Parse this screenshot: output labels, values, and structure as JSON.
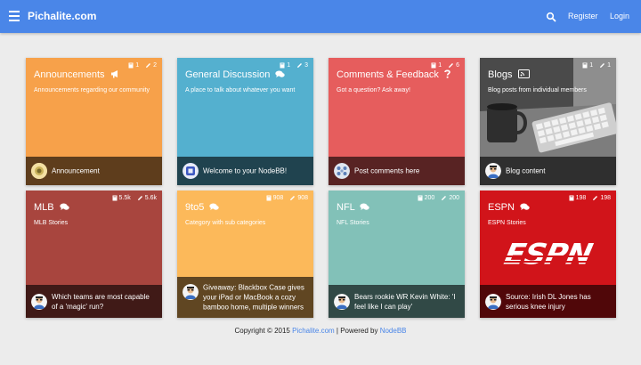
{
  "header": {
    "brand": "Pichalite.com",
    "search_icon": "search-icon",
    "register_label": "Register",
    "login_label": "Login",
    "color": "#4a86e8"
  },
  "categories": [
    {
      "title": "Announcements",
      "icon": "megaphone-icon",
      "description": "Announcements regarding our community",
      "topics": "1",
      "posts": "2",
      "color": "#f7a14a",
      "teaser": "Announcement"
    },
    {
      "title": "General Discussion",
      "icon": "comments-icon",
      "description": "A place to talk about whatever you want",
      "topics": "1",
      "posts": "3",
      "color": "#54b0cf",
      "teaser": "Welcome to your NodeBB!"
    },
    {
      "title": "Comments & Feedback",
      "icon": "question-icon",
      "description": "Got a question? Ask away!",
      "topics": "1",
      "posts": "6",
      "color": "#e65d5d",
      "teaser": "Post comments here"
    },
    {
      "title": "Blogs",
      "icon": "rss-icon",
      "description": "Blog posts from individual members",
      "topics": "1",
      "posts": "1",
      "color": "#5d5d5d",
      "teaser": "Blog content"
    },
    {
      "title": "MLB",
      "icon": "comments-icon",
      "description": "MLB Stories",
      "topics": "5.5k",
      "posts": "5.6k",
      "color": "#a8453e",
      "teaser": "Which teams are most capable of a 'magic' run?"
    },
    {
      "title": "9to5",
      "icon": "comments-icon",
      "description": "Category with sub categories",
      "topics": "908",
      "posts": "908",
      "color": "#fcb95a",
      "teaser": "Giveaway: Blackbox Case gives your iPad or MacBook a cozy bamboo home, multiple winners"
    },
    {
      "title": "NFL",
      "icon": "comments-icon",
      "description": "NFL Stories",
      "topics": "200",
      "posts": "200",
      "color": "#82c1b8",
      "teaser": "Bears rookie WR Kevin White: 'I feel like I can play'"
    },
    {
      "title": "ESPN",
      "icon": "comments-icon",
      "description": "ESPN Stories",
      "topics": "198",
      "posts": "198",
      "color": "#d1141a",
      "teaser": "Source: Irish DL Jones has serious knee injury",
      "logo_text": "ESPN"
    }
  ],
  "footer": {
    "copyright": "Copyright © 2015",
    "site_link": "Pichalite.com",
    "powered_by": "| Powered by",
    "nodebb_link": "NodeBB"
  }
}
